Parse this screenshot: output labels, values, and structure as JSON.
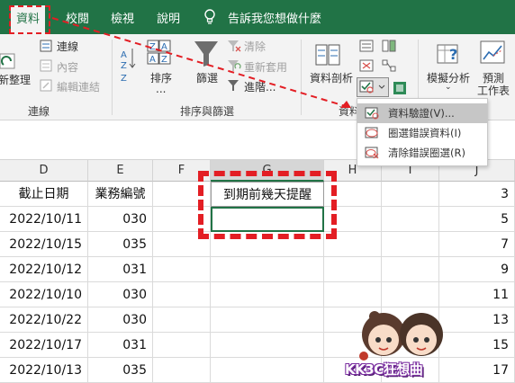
{
  "tabs": {
    "data": "資料",
    "review": "校閱",
    "view": "檢視",
    "help": "說明",
    "tellme": "告訴我您想做什麼"
  },
  "ribbon": {
    "refresh_all": "新整理",
    "connections": "連線",
    "properties": "內容",
    "edit_links": "編輯連結",
    "connections_group": "連線",
    "sort": "排序",
    "sort_more": "...",
    "filter": "篩選",
    "clear": "清除",
    "reapply": "重新套用",
    "advanced": "進階...",
    "sort_filter_group": "排序與篩選",
    "text_to_columns": "資料剖析",
    "data_tools_group": "資料",
    "what_if": "模擬分析",
    "forecast_line1": "預測",
    "forecast_line2": "工作表"
  },
  "dropdown": {
    "items": [
      "資料驗證(V)...",
      "圈選錯誤資料(I)",
      "清除錯誤圈選(R)"
    ]
  },
  "columns": [
    "D",
    "E",
    "F",
    "G",
    "H",
    "I",
    "J"
  ],
  "headers": {
    "deadline": "截止日期",
    "bizno": "業務編號",
    "remind": "到期前幾天提醒"
  },
  "rows": [
    {
      "date": "2022/10/11",
      "bizno": "030",
      "j": "5"
    },
    {
      "date": "2022/10/15",
      "bizno": "035",
      "j": "7"
    },
    {
      "date": "2022/10/12",
      "bizno": "031",
      "j": "9"
    },
    {
      "date": "2022/10/10",
      "bizno": "030",
      "j": "11"
    },
    {
      "date": "2022/10/22",
      "bizno": "030",
      "j": "13"
    },
    {
      "date": "2022/10/17",
      "bizno": "031",
      "j": "15"
    },
    {
      "date": "2022/10/13",
      "bizno": "035",
      "j": "17"
    }
  ],
  "j_first": "3",
  "watermark": "KK3C狂想曲",
  "colors": {
    "excel_green": "#217346",
    "highlight_red": "#e31e24"
  }
}
